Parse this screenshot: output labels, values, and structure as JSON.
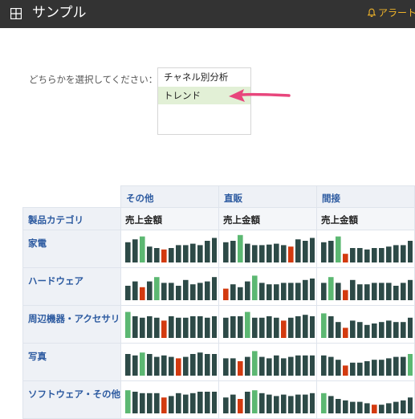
{
  "app": {
    "title": "サンプル",
    "alerts_label": "アラート"
  },
  "selector": {
    "label": "どちらかを選択してください：",
    "options": [
      "チャネル別分析",
      "トレンド"
    ],
    "selected": "トレンド"
  },
  "table": {
    "category_header": "製品カテゴリ",
    "channels": [
      "その他",
      "直販",
      "間接"
    ],
    "measure": "売上金額",
    "categories": [
      "家電",
      "ハードウェア",
      "周辺機器・アクセサリ",
      "写真",
      "ソフトウェア・その他"
    ]
  },
  "colors": {
    "bar": "#2d4a47",
    "high": "#5cb872",
    "low": "#d33a0f"
  },
  "sparklines": [
    [
      [
        0.7,
        0.8,
        0.9,
        0.55,
        0.5,
        0.45,
        0.5,
        0.6,
        0.6,
        0.65,
        0.6,
        0.75,
        0.85
      ],
      [
        0.7,
        0.75,
        0.95,
        0.65,
        0.6,
        0.6,
        0.62,
        0.65,
        0.6,
        0.55,
        0.8,
        0.75,
        0.85
      ],
      [
        0.7,
        0.75,
        0.9,
        0.3,
        0.5,
        0.5,
        0.45,
        0.5,
        0.5,
        0.55,
        0.6,
        0.6,
        0.75
      ]
    ],
    [
      [
        0.5,
        0.65,
        0.45,
        0.65,
        0.8,
        0.6,
        0.6,
        0.5,
        0.7,
        0.55,
        0.6,
        0.65,
        0.8
      ],
      [
        0.4,
        0.55,
        0.45,
        0.65,
        0.85,
        0.6,
        0.55,
        0.55,
        0.6,
        0.6,
        0.6,
        0.7,
        0.75
      ],
      [
        0.6,
        0.8,
        0.6,
        0.35,
        0.7,
        0.55,
        0.55,
        0.6,
        0.6,
        0.6,
        0.5,
        0.6,
        0.7
      ]
    ],
    [
      [
        0.9,
        0.75,
        0.7,
        0.75,
        0.7,
        0.6,
        0.75,
        0.7,
        0.7,
        0.75,
        0.75,
        0.7,
        0.75
      ],
      [
        0.7,
        0.75,
        0.75,
        0.9,
        0.7,
        0.7,
        0.75,
        0.7,
        0.6,
        0.7,
        0.75,
        0.8,
        0.75
      ],
      [
        0.85,
        0.75,
        0.55,
        0.35,
        0.6,
        0.55,
        0.45,
        0.5,
        0.55,
        0.6,
        0.55,
        0.55,
        0.7
      ]
    ],
    [
      [
        0.75,
        0.7,
        0.8,
        0.75,
        0.65,
        0.7,
        0.65,
        0.6,
        0.65,
        0.75,
        0.8,
        0.75,
        0.75
      ],
      [
        0.6,
        0.6,
        0.5,
        0.65,
        0.85,
        0.65,
        0.6,
        0.7,
        0.6,
        0.65,
        0.7,
        0.7,
        0.7
      ],
      [
        0.7,
        0.65,
        0.55,
        0.35,
        0.45,
        0.45,
        0.5,
        0.55,
        0.55,
        0.6,
        0.65,
        0.65,
        0.75
      ]
    ],
    [
      [
        0.8,
        0.75,
        0.7,
        0.7,
        0.7,
        0.55,
        0.6,
        0.7,
        0.65,
        0.7,
        0.75,
        0.75,
        0.75
      ],
      [
        0.55,
        0.65,
        0.5,
        0.75,
        0.8,
        0.7,
        0.65,
        0.6,
        0.65,
        0.6,
        0.65,
        0.65,
        0.7
      ],
      [
        0.7,
        0.6,
        0.5,
        0.45,
        0.4,
        0.4,
        0.35,
        0.3,
        0.3,
        0.35,
        0.4,
        0.45,
        0.55
      ]
    ]
  ]
}
